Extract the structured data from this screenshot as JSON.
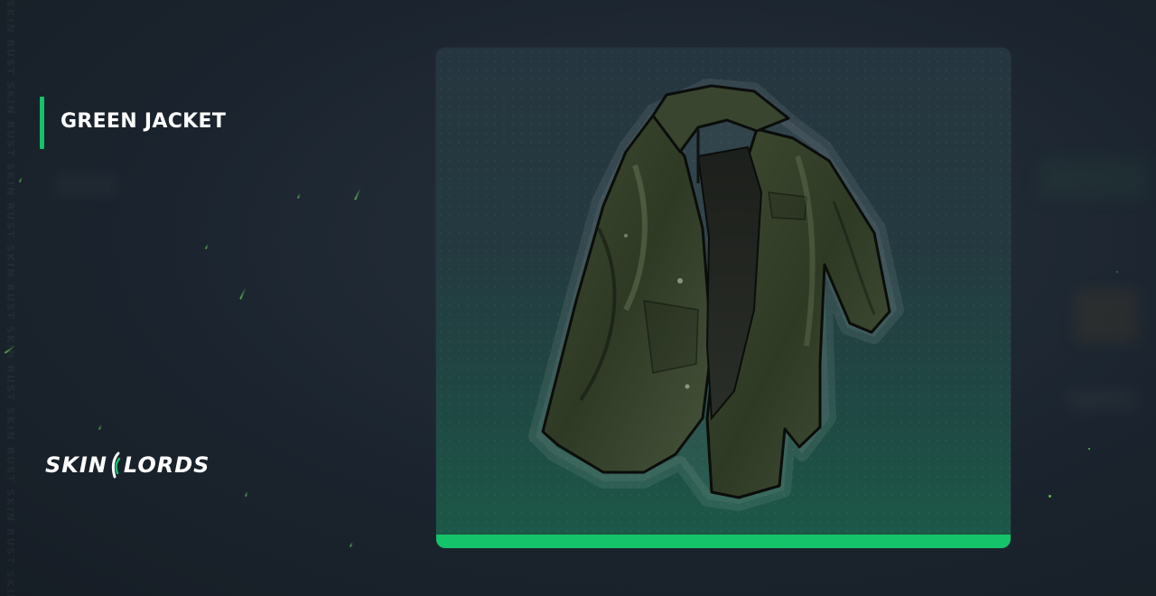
{
  "item": {
    "name": "GREEN JACKET"
  },
  "brand": {
    "logo_left": "SKIN",
    "logo_right": "LORDS",
    "accent_color": "#14c36a"
  },
  "watermark": {
    "side_text": "SKIN RUST SKIN RUST SKIN RUST SKIN RUST SKIN RUST SKIN RUST SKIN RUST SKIN RUST"
  },
  "icons": {
    "item_image": "green-jacket-icon",
    "logo_mark": "skinlords-mark-icon"
  }
}
